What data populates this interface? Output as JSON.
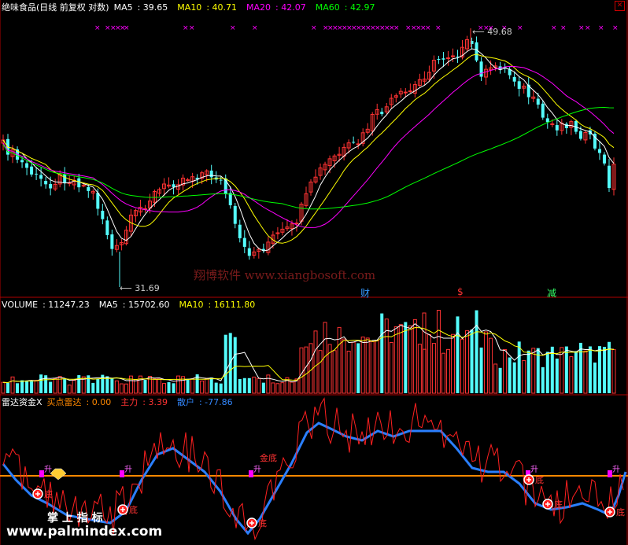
{
  "window": {
    "title": "绝味食品(日线 前复权 对数)",
    "close_icon": "close-icon"
  },
  "price_panel": {
    "ma_labels": [
      {
        "name": "MA5",
        "value": "39.65",
        "color": "#ffffff"
      },
      {
        "name": "MA10",
        "value": "40.71",
        "color": "#ffff00"
      },
      {
        "name": "MA20",
        "value": "42.07",
        "color": "#ff00ff"
      },
      {
        "name": "MA60",
        "value": "42.97",
        "color": "#00ff00"
      }
    ],
    "high_label": "49.68",
    "low_label": "31.69",
    "watermark": "翔博软件 www.xiangbosoft.com",
    "event_markers": [
      {
        "text": "财",
        "color": "#3399ff"
      },
      {
        "text": "$",
        "color": "#ff3333"
      },
      {
        "text": "减",
        "color": "#33ff66"
      }
    ],
    "signal_glyph": "×",
    "signal_color": "#ff00ff"
  },
  "volume_panel": {
    "label": "VOLUME",
    "value": "11247.23",
    "ma5_label": "MA5",
    "ma5_value": "15702.60",
    "ma10_label": "MA10",
    "ma10_value": "16111.80"
  },
  "indicator_panel": {
    "name": "雷达资金X",
    "buy_label": "买点雷达",
    "buy_value": "0.00",
    "main_label": "主力",
    "main_value": "3.39",
    "retail_label": "散户",
    "retail_value": "-77.86",
    "zone_labels": [
      "底",
      "金底",
      "升"
    ],
    "logo_text": "掌 上 指 标",
    "logo_url": "www.palmindex.com"
  },
  "colors": {
    "up": "#ff3333",
    "down": "#54fcfc",
    "ma5": "#ffffff",
    "ma10": "#ffff00",
    "ma20": "#ff00ff",
    "ma60": "#00ff00",
    "divider": "#b00000",
    "retail_line": "#2a7fff",
    "main_line": "#ff2020",
    "orange_line": "#ff8800"
  },
  "chart_data": {
    "type": "candlestick",
    "title": "绝味食品(日线 前复权 对数)",
    "y_range": [
      30.5,
      52
    ],
    "price_high": 49.68,
    "price_low": 31.69,
    "ma_last": {
      "MA5": 39.65,
      "MA10": 40.71,
      "MA20": 42.07,
      "MA60": 42.97
    },
    "volume_last": 11247.23,
    "volume_ma_last": {
      "MA5": 15702.6,
      "MA10": 16111.8
    },
    "indicator_last": {
      "买点雷达": 0.0,
      "主力": 3.39,
      "散户": -77.86
    }
  }
}
